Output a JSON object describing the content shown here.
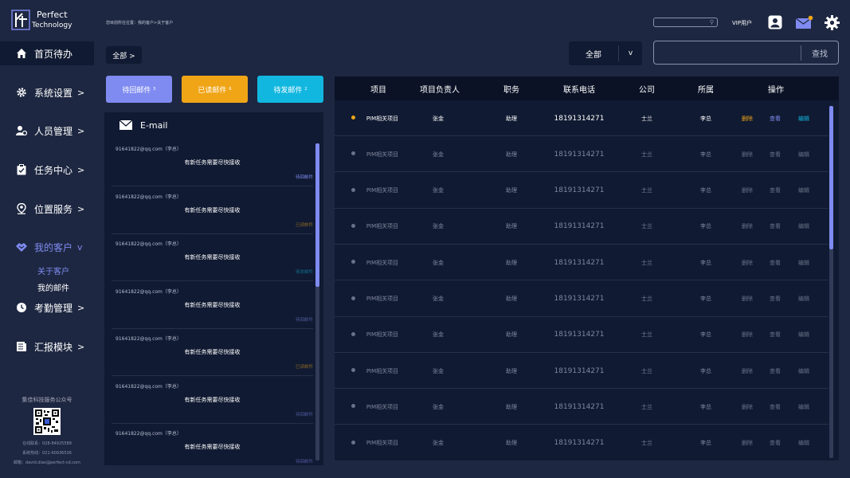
{
  "logo": {
    "line1": "Perfect",
    "line2": "Technology"
  },
  "sidebar": {
    "items": [
      {
        "label": "首页待办",
        "arrow": "",
        "icon": "home-icon"
      },
      {
        "label": "系统设置",
        "arrow": ">",
        "icon": "gear-icon"
      },
      {
        "label": "人员管理",
        "arrow": ">",
        "icon": "users-icon"
      },
      {
        "label": "任务中心",
        "arrow": ">",
        "icon": "clipboard-icon"
      },
      {
        "label": "位置服务",
        "arrow": ">",
        "icon": "location-pin-icon"
      },
      {
        "label": "我的客户",
        "arrow": "v",
        "icon": "handshake-icon"
      },
      {
        "label": "考勤管理",
        "arrow": ">",
        "icon": "clock-icon"
      },
      {
        "label": "汇报模块",
        "arrow": ">",
        "icon": "report-icon"
      }
    ],
    "sub_items": [
      {
        "label": "关于客户"
      },
      {
        "label": "我的邮件"
      }
    ],
    "footer": {
      "title": "集佳科技服务公众号",
      "phone1": "在线联系：028-84925588",
      "phone2": "系统热线：021-60936536",
      "email": "邮箱：david.diao@perfect-cd.com"
    }
  },
  "header": {
    "breadcrumb": "您目前所在位置：我的客户>关于客户",
    "vip_label": "VIP用户"
  },
  "filters": {
    "all_chip": "全部 >",
    "select_value": "全部",
    "select_chevron": "v",
    "search_button": "查找"
  },
  "mail_tabs": [
    {
      "label": "待回邮件",
      "count": "5",
      "color": "#7f8bf0"
    },
    {
      "label": "已读邮件",
      "count": "6",
      "color": "#f0a517"
    },
    {
      "label": "待发邮件",
      "count": "2",
      "color": "#12b7e0"
    }
  ],
  "email_panel": {
    "title": "E-mail",
    "items": [
      {
        "from": "91641822@qq.com（李总）",
        "subject": "有新任务需要尽快接收",
        "status": "待回邮件",
        "status_color": "#7f8bf0",
        "bright": true
      },
      {
        "from": "91641822@qq.com（李总）",
        "subject": "有新任务需要尽快接收",
        "status": "已读邮件",
        "status_color": "#f0a517",
        "bright": false
      },
      {
        "from": "91641822@qq.com（李总）",
        "subject": "有新任务需要尽快接收",
        "status": "待发邮件",
        "status_color": "#12b7e0",
        "bright": false
      },
      {
        "from": "91641822@qq.com（李总）",
        "subject": "有新任务需要尽快接收",
        "status": "待回邮件",
        "status_color": "#7f8bf0",
        "bright": false
      },
      {
        "from": "91641822@qq.com（李总）",
        "subject": "有新任务需要尽快接收",
        "status": "已读邮件",
        "status_color": "#f0a517",
        "bright": false
      },
      {
        "from": "91641822@qq.com（李总）",
        "subject": "有新任务需要尽快接收",
        "status": "待回邮件",
        "status_color": "#7f8bf0",
        "bright": false
      },
      {
        "from": "91641822@qq.com（李总）",
        "subject": "有新任务需要尽快接收",
        "status": "待回邮件",
        "status_color": "#7f8bf0",
        "bright": false
      }
    ]
  },
  "table": {
    "headers": [
      "项目",
      "项目负责人",
      "职务",
      "联系电话",
      "公司",
      "所属",
      "操作"
    ],
    "actions": {
      "delete": "删除",
      "view": "查看",
      "edit": "编辑"
    },
    "rows": [
      {
        "project": "PIM相关项目",
        "owner": "张金",
        "position": "助理",
        "phone": "18191314271",
        "company": "士兰",
        "belongs": "李总",
        "highlight": true
      },
      {
        "project": "PIM相关项目",
        "owner": "张金",
        "position": "助理",
        "phone": "18191314271",
        "company": "士兰",
        "belongs": "李总",
        "highlight": false
      },
      {
        "project": "PIM相关项目",
        "owner": "张金",
        "position": "助理",
        "phone": "18191314271",
        "company": "士兰",
        "belongs": "李总",
        "highlight": false
      },
      {
        "project": "PIM相关项目",
        "owner": "张金",
        "position": "助理",
        "phone": "18191314271",
        "company": "士兰",
        "belongs": "李总",
        "highlight": false
      },
      {
        "project": "PIM相关项目",
        "owner": "张金",
        "position": "助理",
        "phone": "18191314271",
        "company": "士兰",
        "belongs": "李总",
        "highlight": false
      },
      {
        "project": "PIM相关项目",
        "owner": "张金",
        "position": "助理",
        "phone": "18191314271",
        "company": "士兰",
        "belongs": "李总",
        "highlight": false
      },
      {
        "project": "PIM相关项目",
        "owner": "张金",
        "position": "助理",
        "phone": "18191314271",
        "company": "士兰",
        "belongs": "李总",
        "highlight": false
      },
      {
        "project": "PIM相关项目",
        "owner": "张金",
        "position": "助理",
        "phone": "18191314271",
        "company": "士兰",
        "belongs": "李总",
        "highlight": false
      },
      {
        "project": "PIM相关项目",
        "owner": "张金",
        "position": "助理",
        "phone": "18191314271",
        "company": "士兰",
        "belongs": "李总",
        "highlight": false
      },
      {
        "project": "PIM相关项目",
        "owner": "张金",
        "position": "助理",
        "phone": "18191314271",
        "company": "士兰",
        "belongs": "李总",
        "highlight": false
      }
    ]
  },
  "colors": {
    "accent": "#7f8bf0",
    "orange": "#f0a517",
    "cyan": "#12b7e0",
    "bg": "#1d2741",
    "panel": "#101a32"
  }
}
